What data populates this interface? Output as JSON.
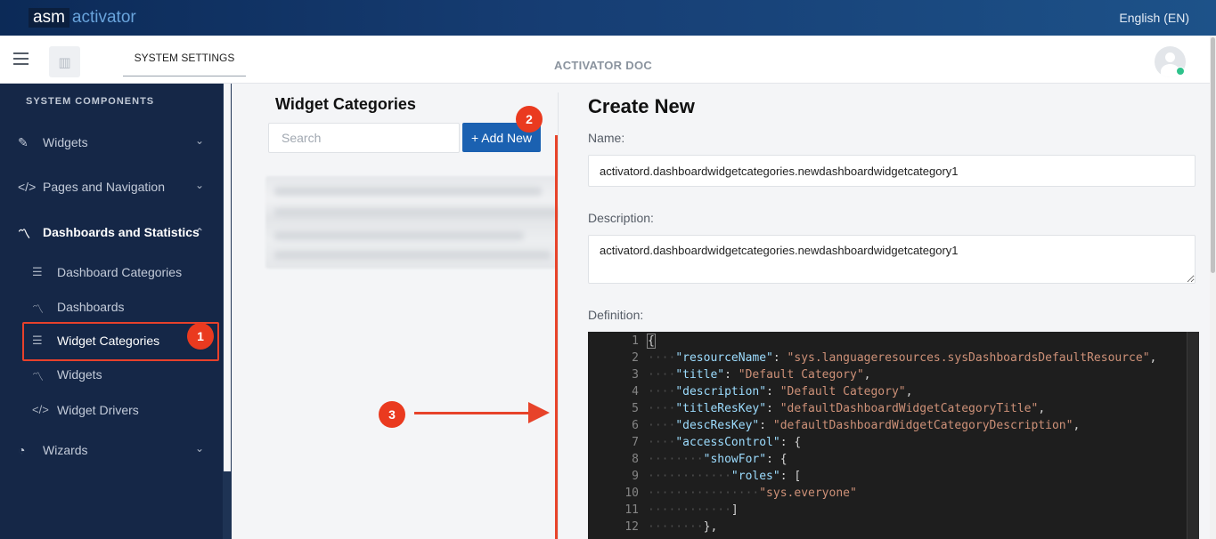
{
  "topbar": {
    "logo_part1": "asm",
    "logo_part2": "activator",
    "language": "English (EN)"
  },
  "header": {
    "system_settings_label": "SYSTEM SETTINGS",
    "center_title": "ACTIVATOR DOC"
  },
  "sidebar": {
    "heading": "SYSTEM COMPONENTS",
    "items": [
      {
        "label": "Widgets",
        "icon": "widget-edit-icon",
        "expanded": false
      },
      {
        "label": "Pages and Navigation",
        "icon": "code-icon",
        "expanded": false
      },
      {
        "label": "Dashboards and Statistics",
        "icon": "chart-line-icon",
        "expanded": true
      },
      {
        "label": "Wizards",
        "icon": "wizard-icon",
        "expanded": false
      }
    ],
    "subitems": [
      {
        "label": "Dashboard Categories",
        "icon": "list-check-icon"
      },
      {
        "label": "Dashboards",
        "icon": "chart-line-icon"
      },
      {
        "label": "Widget Categories",
        "icon": "list-check-icon"
      },
      {
        "label": "Widgets",
        "icon": "chart-line-icon"
      },
      {
        "label": "Widget Drivers",
        "icon": "code-icon"
      }
    ]
  },
  "annotations": {
    "step1": "1",
    "step2": "2",
    "step3": "3",
    "accent_color": "#e7432a"
  },
  "middle": {
    "title": "Widget Categories",
    "search_placeholder": "Search",
    "add_button_label": "+ Add New"
  },
  "form": {
    "title": "Create New",
    "name_label": "Name:",
    "name_value": "activatord.dashboardwidgetcategories.newdashboardwidgetcategory1",
    "description_label": "Description:",
    "description_value": "activatord.dashboardwidgetcategories.newdashboardwidgetcategory1",
    "definition_label": "Definition:"
  },
  "editor_lines": [
    {
      "n": "1",
      "indent": "",
      "parts": [
        [
          "p",
          "{"
        ]
      ]
    },
    {
      "n": "2",
      "indent": "····",
      "parts": [
        [
          "k",
          "\"resourceName\""
        ],
        [
          "p",
          ": "
        ],
        [
          "s",
          "\"sys.languageresources.sysDashboardsDefaultResource\""
        ],
        [
          "p",
          ","
        ]
      ]
    },
    {
      "n": "3",
      "indent": "····",
      "parts": [
        [
          "k",
          "\"title\""
        ],
        [
          "p",
          ": "
        ],
        [
          "s",
          "\"Default Category\""
        ],
        [
          "p",
          ","
        ]
      ]
    },
    {
      "n": "4",
      "indent": "····",
      "parts": [
        [
          "k",
          "\"description\""
        ],
        [
          "p",
          ": "
        ],
        [
          "s",
          "\"Default Category\""
        ],
        [
          "p",
          ","
        ]
      ]
    },
    {
      "n": "5",
      "indent": "····",
      "parts": [
        [
          "k",
          "\"titleResKey\""
        ],
        [
          "p",
          ": "
        ],
        [
          "s",
          "\"defaultDashboardWidgetCategoryTitle\""
        ],
        [
          "p",
          ","
        ]
      ]
    },
    {
      "n": "6",
      "indent": "····",
      "parts": [
        [
          "k",
          "\"descResKey\""
        ],
        [
          "p",
          ": "
        ],
        [
          "s",
          "\"defaultDashboardWidgetCategoryDescription\""
        ],
        [
          "p",
          ","
        ]
      ]
    },
    {
      "n": "7",
      "indent": "····",
      "parts": [
        [
          "k",
          "\"accessControl\""
        ],
        [
          "p",
          ": {"
        ]
      ]
    },
    {
      "n": "8",
      "indent": "········",
      "parts": [
        [
          "k",
          "\"showFor\""
        ],
        [
          "p",
          ": {"
        ]
      ]
    },
    {
      "n": "9",
      "indent": "············",
      "parts": [
        [
          "k",
          "\"roles\""
        ],
        [
          "p",
          ": ["
        ]
      ]
    },
    {
      "n": "10",
      "indent": "················",
      "parts": [
        [
          "s",
          "\"sys.everyone\""
        ]
      ]
    },
    {
      "n": "11",
      "indent": "············",
      "parts": [
        [
          "p",
          "]"
        ]
      ]
    },
    {
      "n": "12",
      "indent": "········",
      "parts": [
        [
          "p",
          "},"
        ]
      ]
    }
  ]
}
